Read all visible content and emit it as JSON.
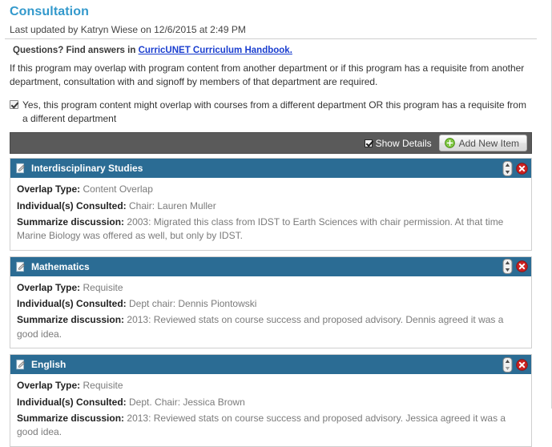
{
  "header": {
    "title": "Consultation",
    "last_updated": "Last updated by Katryn Wiese on 12/6/2015 at 2:49 PM",
    "questions_prefix": "Questions? Find answers in ",
    "questions_link": "CurricUNET Curriculum Handbook.",
    "intro": "If this program may overlap with program content from another department or if this program has a requisite from another department, consultation with and signoff by members of that department are required."
  },
  "consent": {
    "label": "Yes, this program content might overlap with courses from a different department OR this program has a requisite from a different department",
    "checked": true
  },
  "toolbar": {
    "show_details_label": "Show Details",
    "show_details_checked": true,
    "add_new_item_label": "Add New Item",
    "add_icon": "plus-circle-icon"
  },
  "labels": {
    "overlap_type": "Overlap Type:",
    "individuals_consulted": "Individual(s) Consulted:",
    "summarize_discussion": "Summarize discussion:"
  },
  "colors": {
    "title_blue": "#3399cc",
    "card_header_blue": "#2b6c94",
    "toolbar_gray": "#5a5a5a",
    "link_blue": "#1a3ecf",
    "add_icon_green": "#6fbf2a",
    "delete_icon_red": "#cc2222"
  },
  "items": [
    {
      "title": "Interdisciplinary Studies",
      "icon": "edit-page-icon",
      "overlap_type": "Content Overlap",
      "individuals_consulted": "Chair: Lauren Muller",
      "summarize_discussion": "2003: Migrated this class from IDST to Earth Sciences with chair permission. At that time Marine Biology was offered as well, but only by IDST."
    },
    {
      "title": "Mathematics",
      "icon": "edit-page-icon",
      "overlap_type": "Requisite",
      "individuals_consulted": "Dept chair: Dennis Piontowski",
      "summarize_discussion": "2013: Reviewed stats on course success and proposed advisory. Dennis agreed it was a good idea."
    },
    {
      "title": "English",
      "icon": "edit-page-icon",
      "overlap_type": "Requisite",
      "individuals_consulted": "Dept. Chair: Jessica Brown",
      "summarize_discussion": "2013: Reviewed stats on course success and proposed advisory. Jessica agreed it was a good idea."
    }
  ]
}
